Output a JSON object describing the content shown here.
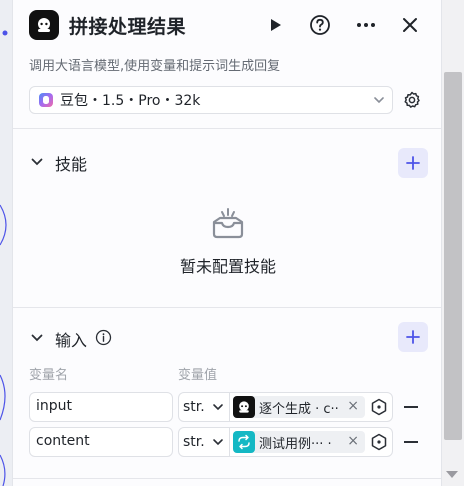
{
  "node": {
    "title": "拼接处理结果",
    "description": "调用大语言模型,使用变量和提示词生成回复"
  },
  "model": {
    "label": "豆包・1.5・Pro・32k"
  },
  "skills": {
    "title": "技能",
    "empty_text": "暂未配置技能"
  },
  "inputs": {
    "title": "输入",
    "col_name": "变量名",
    "col_value": "变量值",
    "rows": [
      {
        "name": "input",
        "type": "str.",
        "ref_text": "逐个生成 · c··",
        "ref_icon": "bot-icon",
        "ref_color": "#111111"
      },
      {
        "name": "content",
        "type": "str.",
        "ref_text": "测试用例··· ·",
        "ref_icon": "loop-icon",
        "ref_color": "#14b8c4"
      }
    ]
  },
  "colors": {
    "accent": "#4d53e8",
    "add_bg": "#e8e9fb"
  }
}
